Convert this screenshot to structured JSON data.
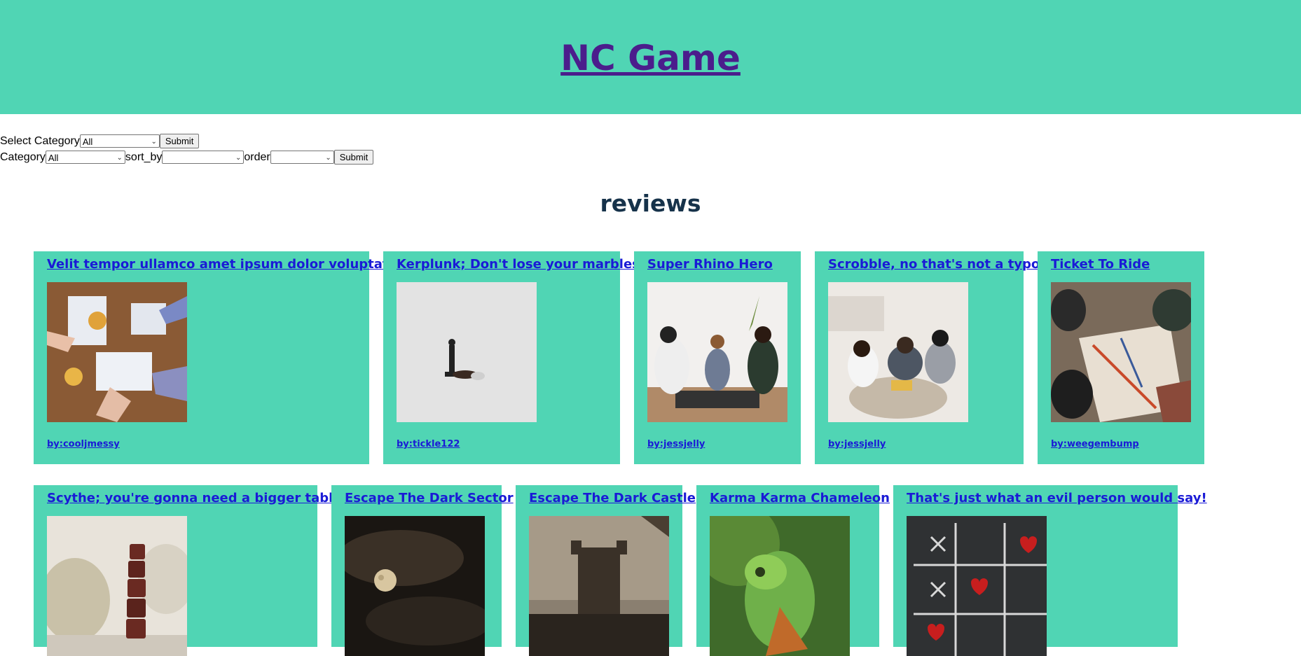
{
  "header": {
    "title": "NC Game"
  },
  "filter1": {
    "label": "Select Category",
    "select_value": "All",
    "submit_label": "Submit"
  },
  "filter2": {
    "category_label": "Category",
    "category_value": "All",
    "sort_label": "sort_by",
    "sort_value": "",
    "order_label": "order",
    "order_value": "",
    "submit_label": "Submit"
  },
  "reviews_heading": "reviews",
  "colors": {
    "accent": "#50d5b4",
    "title": "#4b1d8c",
    "link": "#1a1ad6"
  },
  "reviews": [
    {
      "title": "Velit tempor ullamco amet ipsum dolor voluptate.",
      "author": "by:cooljmessy",
      "image": "people-playing-board-game"
    },
    {
      "title": "Kerplunk; Don't lose your marbles",
      "author": "by:tickle122",
      "image": "fallen-chess-pieces"
    },
    {
      "title": "Super Rhino Hero",
      "author": "by:jessjelly",
      "image": "family-playing-on-floor"
    },
    {
      "title": "Scrobble, no that's not a typo",
      "author": "by:jessjelly",
      "image": "family-game-night"
    },
    {
      "title": "Ticket To Ride",
      "author": "by:weegembump",
      "image": "ticket-to-ride-board"
    },
    {
      "title": "Scythe; you're gonna need a bigger table!",
      "author": "",
      "image": "stacked-dice"
    },
    {
      "title": "Escape The Dark Sector",
      "author": "",
      "image": "moon-in-clouds"
    },
    {
      "title": "Escape The Dark Castle",
      "author": "",
      "image": "dark-castle"
    },
    {
      "title": "Karma Karma Chameleon",
      "author": "",
      "image": "green-chameleon"
    },
    {
      "title": "That's just what an evil person would say!",
      "author": "",
      "image": "tic-tac-toe-hearts"
    }
  ]
}
